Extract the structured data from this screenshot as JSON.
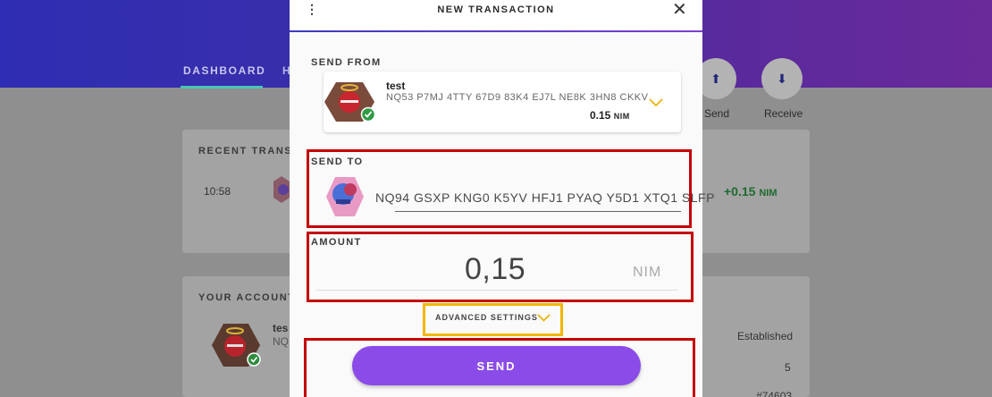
{
  "background": {
    "tabs": [
      "DASHBOARD",
      "H"
    ],
    "recent_title": "RECENT TRANSA",
    "recent_time": "10:58",
    "recent_amount": "+0.15",
    "recent_unit": "NIM",
    "accounts_title": "YOUR ACCOUNT",
    "account_name_partial": "tes",
    "account_addr_partial": "NQ",
    "send_label": "Send",
    "receive_label": "Receive",
    "established": "Established",
    "count": "5",
    "block_partial": "#74603"
  },
  "modal": {
    "title": "NEW TRANSACTION",
    "send_from_label": "SEND FROM",
    "from_account": {
      "name": "test",
      "address": "NQ53 P7MJ 4TTY 67D9 83K4 EJ7L NE8K 3HN8 CKKV",
      "balance": "0.15",
      "unit": "NIM"
    },
    "send_to_label": "SEND TO",
    "to_address": "NQ94 GSXP KNG0 K5YV HFJ1 PYAQ Y5D1 XTQ1 SLFP",
    "amount_label": "AMOUNT",
    "amount_value": "0,15",
    "amount_unit": "NIM",
    "advanced_label": "ADVANCED SETTINGS",
    "send_button": "SEND"
  },
  "colors": {
    "accent": "#8b4be8",
    "highlight_red": "#c40000",
    "highlight_orange": "#f2b600",
    "chevron": "#e9b100"
  }
}
